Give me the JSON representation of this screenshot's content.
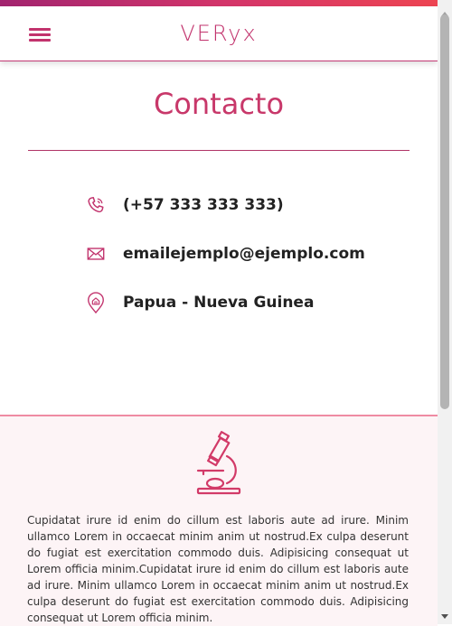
{
  "header": {
    "brand": "VERyx",
    "menu_icon": "hamburger-menu-icon"
  },
  "page": {
    "title": "Contacto"
  },
  "contact": {
    "items": [
      {
        "icon": "phone-icon",
        "text": "(+57 333 333 333)"
      },
      {
        "icon": "mail-icon",
        "text": "emailejemplo@ejemplo.com"
      },
      {
        "icon": "location-pin-icon",
        "text": "Papua - Nueva Guinea"
      }
    ]
  },
  "footer": {
    "icon": "microscope-icon",
    "text": "Cupidatat irure id enim do cillum est laboris aute ad irure. Minim ullamco Lorem in occaecat minim anim ut nostrud.Ex culpa deserunt do fugiat est exercitation commodo duis. Adipisicing consequat ut Lorem officia minim.Cupidatat irure id enim do cillum est laboris aute ad irure. Minim ullamco Lorem in occaecat minim anim ut nostrud.Ex culpa deserunt do fugiat est exercitation commodo duis. Adipisicing consequat ut Lorem officia minim."
  },
  "colors": {
    "accent": "#c2336d",
    "footer_bg": "#fdf4f6",
    "gradient_start": "#a2246f",
    "gradient_end": "#ef4550"
  }
}
